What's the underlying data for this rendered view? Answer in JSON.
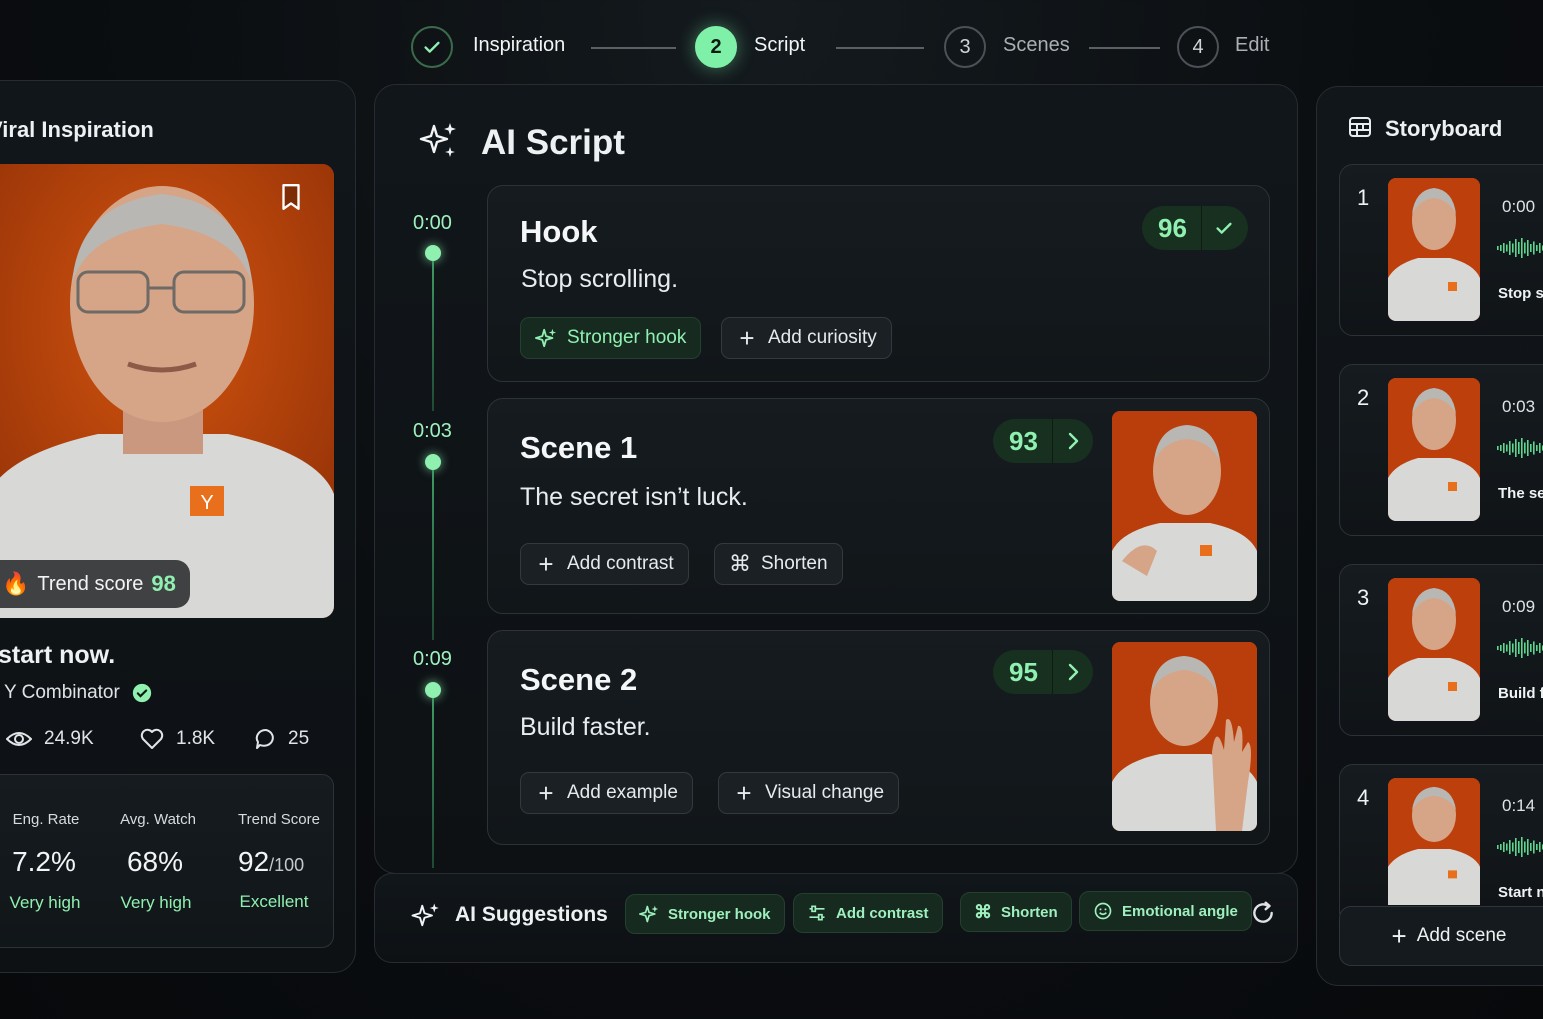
{
  "stepper": {
    "steps": [
      {
        "number": "",
        "label": "Inspiration",
        "state": "done"
      },
      {
        "number": "2",
        "label": "Script",
        "state": "active"
      },
      {
        "number": "3",
        "label": "Scenes",
        "state": "pending"
      },
      {
        "number": "4",
        "label": "Edit",
        "state": "pending"
      }
    ]
  },
  "inspiration": {
    "title": "Viral Inspiration",
    "trend_label": "Trend score",
    "trend_value": "98",
    "video_title": "start now.",
    "channel": "Y Combinator",
    "views": "24.9K",
    "likes": "1.8K",
    "comments": "25",
    "metrics": [
      {
        "label": "Eng. Rate",
        "value": "7.2%",
        "suffix": "",
        "status": "Very high"
      },
      {
        "label": "Avg. Watch",
        "value": "68%",
        "suffix": "",
        "status": "Very high"
      },
      {
        "label": "Trend Score",
        "value": "92",
        "suffix": "/100",
        "status": "Excellent"
      }
    ]
  },
  "script": {
    "title": "AI Script",
    "timeline": [
      "0:00",
      "0:03",
      "0:09"
    ],
    "sections": [
      {
        "title": "Hook",
        "text": "Stop scrolling.",
        "score": "96",
        "actions": [
          "Stronger hook",
          "Add curiosity"
        ]
      },
      {
        "title": "Scene 1",
        "text": "The secret isn’t luck.",
        "score": "93",
        "actions": [
          "Add contrast",
          "Shorten"
        ]
      },
      {
        "title": "Scene 2",
        "text": "Build faster.",
        "score": "95",
        "actions": [
          "Add example",
          "Visual change"
        ]
      }
    ]
  },
  "suggestions": {
    "title": "AI Suggestions",
    "items": [
      "Stronger hook",
      "Add contrast",
      "Shorten",
      "Emotional angle"
    ]
  },
  "storyboard": {
    "title": "Storyboard",
    "scenes": [
      {
        "num": "1",
        "time": "0:00",
        "caption": "Stop sc"
      },
      {
        "num": "2",
        "time": "0:03",
        "caption": "The se"
      },
      {
        "num": "3",
        "time": "0:09",
        "caption": "Build fa"
      },
      {
        "num": "4",
        "time": "0:14",
        "caption": "Start n"
      }
    ],
    "add_label": "Add scene"
  },
  "colors": {
    "accent": "#8ff0b0",
    "background": "#0b0e11",
    "orange": "#c0400c"
  }
}
